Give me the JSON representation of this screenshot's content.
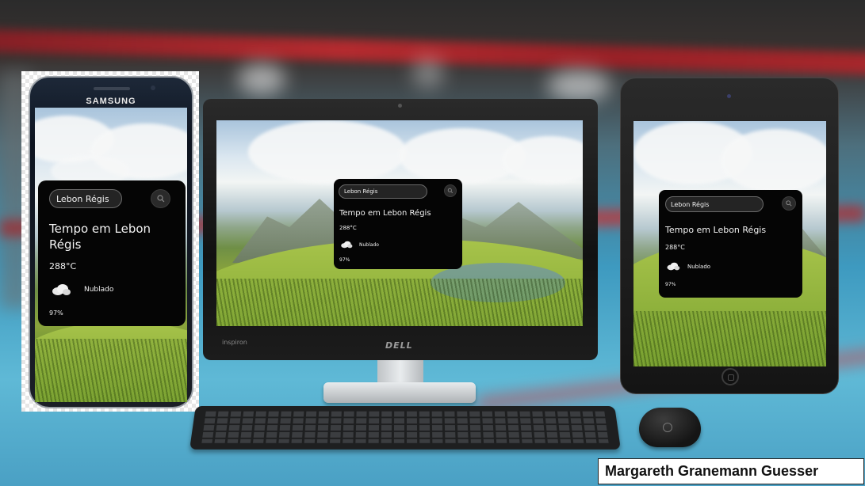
{
  "phone": {
    "brand": "SAMSUNG",
    "widget": {
      "city_input": "Lebon Régis",
      "title": "Tempo em Lebon Régis",
      "temperature": "288°C",
      "description": "Nublado",
      "humidity": "97%"
    }
  },
  "monitor": {
    "brand_label": "inspiron",
    "logo_text": "DELL",
    "widget": {
      "city_input": "Lebon Régis",
      "title": "Tempo em Lebon Régis",
      "temperature": "288°C",
      "description": "Nublado",
      "humidity": "97%"
    }
  },
  "tablet": {
    "widget": {
      "city_input": "Lebon Régis",
      "title": "Tempo em Lebon Régis",
      "temperature": "288°C",
      "description": "Nublado",
      "humidity": "97%"
    }
  },
  "author": "Margareth Granemann Guesser",
  "icons": {
    "search": "search-icon",
    "weather": "cloud-icon"
  },
  "colors": {
    "card": "#050505",
    "text": "#f2f2f2",
    "input": "#242424",
    "author_bg": "#ffffff"
  }
}
